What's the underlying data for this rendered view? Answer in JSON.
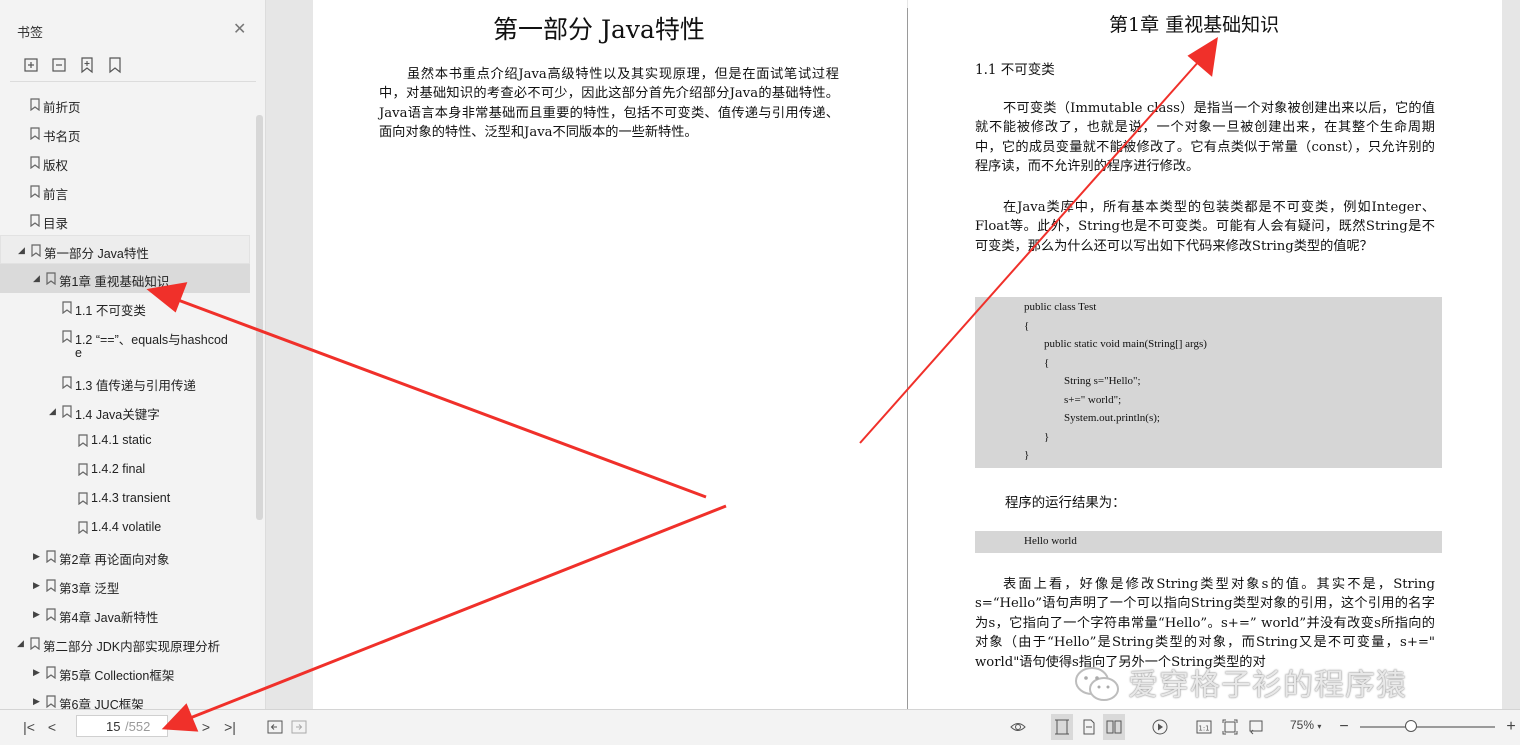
{
  "sidebar": {
    "title": "书签",
    "tools": [
      "expand-all-icon",
      "collapse-all-icon",
      "add-bookmark-icon",
      "bookmark-list-icon"
    ],
    "items": [
      {
        "label": "前折页",
        "level": 0,
        "expander": "none"
      },
      {
        "label": "书名页",
        "level": 0,
        "expander": "none"
      },
      {
        "label": "版权",
        "level": 0,
        "expander": "none"
      },
      {
        "label": "前言",
        "level": 0,
        "expander": "none"
      },
      {
        "label": "目录",
        "level": 0,
        "expander": "none"
      },
      {
        "label": "第一部分 Java特性",
        "level": 0,
        "expander": "expanded"
      },
      {
        "label": "第1章 重视基础知识",
        "level": 1,
        "expander": "expanded"
      },
      {
        "label": "1.1 不可变类",
        "level": 2,
        "expander": "none"
      },
      {
        "label": "1.2 “==”、equals与hashcod",
        "label2": "e",
        "level": 2,
        "expander": "none"
      },
      {
        "label": "1.3 值传递与引用传递",
        "level": 2,
        "expander": "none"
      },
      {
        "label": "1.4 Java关键字",
        "level": 2,
        "expander": "expanded"
      },
      {
        "label": "1.4.1 static",
        "level": 3,
        "expander": "none"
      },
      {
        "label": "1.4.2 final",
        "level": 3,
        "expander": "none"
      },
      {
        "label": "1.4.3 transient",
        "level": 3,
        "expander": "none"
      },
      {
        "label": "1.4.4 volatile",
        "level": 3,
        "expander": "none"
      },
      {
        "label": "第2章 再论面向对象",
        "level": 1,
        "expander": "collapsed"
      },
      {
        "label": "第3章 泛型",
        "level": 1,
        "expander": "collapsed"
      },
      {
        "label": "第4章 Java新特性",
        "level": 1,
        "expander": "collapsed"
      },
      {
        "label": "第二部分 JDK内部实现原理分析",
        "level": 0,
        "expander": "expanded"
      },
      {
        "label": "第5章 Collection框架",
        "level": 1,
        "expander": "collapsed"
      },
      {
        "label": "第6章 JUC框架",
        "level": 1,
        "expander": "collapsed"
      }
    ]
  },
  "left_page": {
    "heading": "第一部分 Java特性",
    "paragraph": "虽然本书重点介绍Java高级特性以及其实现原理，但是在面试笔试过程中，对基础知识的考查必不可少，因此这部分首先介绍部分Java的基础特性。Java语言本身非常基础而且重要的特性，包括不可变类、值传递与引用传递、面向对象的特性、泛型和Java不同版本的一些新特性。"
  },
  "right_page": {
    "chapter_title": "第1章 重视基础知识",
    "section_title": "1.1 不可变类",
    "para1": "不可变类（Immutable class）是指当一个对象被创建出来以后，它的值就不能被修改了，也就是说，一个对象一旦被创建出来，在其整个生命周期中，它的成员变量就不能被修改了。它有点类似于常量（const），只允许别的程序读，而不允许别的程序进行修改。",
    "para2": "在Java类库中，所有基本类型的包装类都是不可变类，例如Integer、Float等。此外，String也是不可变类。可能有人会有疑问，既然String是不可变类，那么为什么还可以写出如下代码来修改String类型的值呢？",
    "code_lines": [
      "public class Test",
      "{",
      "public static void main(String[] args)",
      "{",
      "String s=\"Hello\";",
      "s+=\" world\";",
      "System.out.println(s);",
      "}",
      "}"
    ],
    "result_label": "程序的运行结果为：",
    "result_output": "Hello world",
    "para3": "表面上看，好像是修改String类型对象s的值。其实不是，String s=“Hello”语句声明了一个可以指向String类型对象的引用，这个引用的名字为s，它指向了一个字符串常量“Hello”。s+=” world”并没有改变s所指向的对象（由于“Hello”是String类型的对象，而String又是不可变量，s+=\" world\"语句使得s指向了另外一个String类型的对"
  },
  "bottom_bar": {
    "current_page": "15",
    "total_pages": "/552",
    "zoom": "75%"
  },
  "watermark": "爱穿格子衫的程序猿",
  "colors": {
    "annotation_arrow": "#f0302a",
    "selected_row": "#dadada",
    "code_bg": "#d6d6d6"
  }
}
